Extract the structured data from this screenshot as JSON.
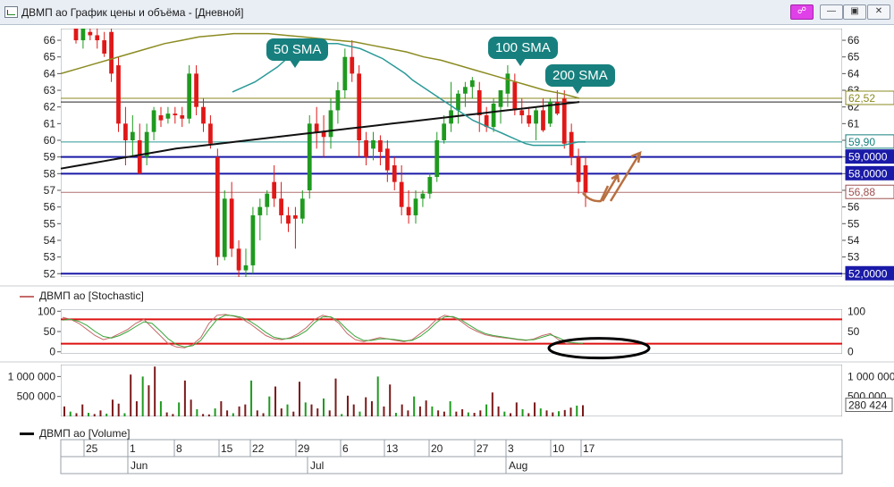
{
  "window": {
    "title": "ДВМП ао График цены и объёма - [Дневной]",
    "buttons": [
      "☍",
      "—",
      "▣",
      "✕"
    ]
  },
  "annotations": {
    "sma50": "50 SMA",
    "sma100": "100 SMA",
    "sma200": "200 SMA"
  },
  "legends": {
    "stochastic": "ДВМП ао [Stochastic]",
    "volume": "ДВМП ао [Volume]"
  },
  "price_tags": {
    "sma200": {
      "label": "62,52",
      "value": 62.52,
      "color": "#8b8b22"
    },
    "sma50": {
      "label": "59,90",
      "value": 59.9,
      "color": "#17807e"
    },
    "level59": {
      "label": "59,0000",
      "value": 59.0,
      "color": "#1a1aa8"
    },
    "level58": {
      "label": "58,0000",
      "value": 58.0,
      "color": "#1a1aa8"
    },
    "last": {
      "label": "56,88",
      "value": 56.88,
      "color": "#a05050"
    },
    "level52": {
      "label": "52,0000",
      "value": 52.0,
      "color": "#1a1aa8"
    },
    "volume_last": {
      "label": "280 424",
      "value": 280424
    }
  },
  "colors": {
    "up": "#1f9a1f",
    "down": "#e01818",
    "sma50": "#2a9a98",
    "sma100": "#111111",
    "sma200": "#8b8b22",
    "level": "#1a1aa8",
    "stoch_band": "#dd1111",
    "draw": "#b87040"
  },
  "chart_data": [
    {
      "type": "candlestick",
      "ylim": [
        51.8,
        66.7
      ],
      "yticks": [
        52,
        53,
        54,
        55,
        56,
        57,
        58,
        59,
        60,
        61,
        62,
        63,
        64,
        65,
        66
      ],
      "x_labels": [
        "25",
        "1",
        "8",
        "15",
        "22",
        "29",
        "6",
        "13",
        "20",
        "27",
        "3",
        "10",
        "17"
      ],
      "month_labels": [
        "Jun",
        "Jul",
        "Aug"
      ],
      "horizontal_lines": [
        62.52,
        62.3,
        59.9,
        59.0,
        58.0,
        56.88,
        52.0
      ],
      "ohlc": [
        [
          67.0,
          67.5,
          65.8,
          66.0
        ],
        [
          66.0,
          67.0,
          65.5,
          66.8
        ],
        [
          66.5,
          67.0,
          66.0,
          66.3
        ],
        [
          66.3,
          67.0,
          65.5,
          66.0
        ],
        [
          66.0,
          66.5,
          65.0,
          65.2
        ],
        [
          66.5,
          66.8,
          63.5,
          64.0
        ],
        [
          64.5,
          65.0,
          60.5,
          61.0
        ],
        [
          61.0,
          62.0,
          58.5,
          60.0
        ],
        [
          60.0,
          61.5,
          59.0,
          60.5
        ],
        [
          60.0,
          61.0,
          58.0,
          58.0
        ],
        [
          59.0,
          61.0,
          58.5,
          60.5
        ],
        [
          60.5,
          62.0,
          60.0,
          61.8
        ],
        [
          61.5,
          62.0,
          60.8,
          61.2
        ],
        [
          61.3,
          62.0,
          61.0,
          61.6
        ],
        [
          61.6,
          62.0,
          61.0,
          61.5
        ],
        [
          61.5,
          62.0,
          60.8,
          61.3
        ],
        [
          61.3,
          64.5,
          61.0,
          64.0
        ],
        [
          64.0,
          64.5,
          61.5,
          62.0
        ],
        [
          62.0,
          62.5,
          60.5,
          61.0
        ],
        [
          61.0,
          61.5,
          59.5,
          59.8
        ],
        [
          59.0,
          59.5,
          52.5,
          53.0
        ],
        [
          53.0,
          57.0,
          52.8,
          56.5
        ],
        [
          56.5,
          57.5,
          53.0,
          53.5
        ],
        [
          53.5,
          54.0,
          51.8,
          52.2
        ],
        [
          52.2,
          53.5,
          51.8,
          52.5
        ],
        [
          52.5,
          56.0,
          52.0,
          55.5
        ],
        [
          55.5,
          56.5,
          54.0,
          56.0
        ],
        [
          56.0,
          57.0,
          55.5,
          56.8
        ],
        [
          57.5,
          58.5,
          56.0,
          56.5
        ],
        [
          56.5,
          57.5,
          55.0,
          55.5
        ],
        [
          55.5,
          56.0,
          54.5,
          55.0
        ],
        [
          55.5,
          56.0,
          53.5,
          55.3
        ],
        [
          55.3,
          57.0,
          55.0,
          56.5
        ],
        [
          57.0,
          61.5,
          56.5,
          61.0
        ],
        [
          61.0,
          62.0,
          59.5,
          60.5
        ],
        [
          60.5,
          61.5,
          59.0,
          60.2
        ],
        [
          60.2,
          62.5,
          59.5,
          61.8
        ],
        [
          61.8,
          63.5,
          61.0,
          63.0
        ],
        [
          63.0,
          65.5,
          62.5,
          65.0
        ],
        [
          65.0,
          66.0,
          63.5,
          64.0
        ],
        [
          64.0,
          64.5,
          59.0,
          60.0
        ],
        [
          60.0,
          60.5,
          58.5,
          59.0
        ],
        [
          59.5,
          60.5,
          58.8,
          60.0
        ],
        [
          60.0,
          60.3,
          58.5,
          59.3
        ],
        [
          59.5,
          60.0,
          57.5,
          58.2
        ],
        [
          58.5,
          59.0,
          57.0,
          57.5
        ],
        [
          57.5,
          58.5,
          55.5,
          56.0
        ],
        [
          56.0,
          57.0,
          55.0,
          55.5
        ],
        [
          55.5,
          57.0,
          55.0,
          56.5
        ],
        [
          56.5,
          57.0,
          56.0,
          56.8
        ],
        [
          56.8,
          58.0,
          56.5,
          57.8
        ],
        [
          57.8,
          60.5,
          57.5,
          60.0
        ],
        [
          60.0,
          61.5,
          59.8,
          61.0
        ],
        [
          61.0,
          63.5,
          60.5,
          61.8
        ],
        [
          61.8,
          63.0,
          61.0,
          62.8
        ],
        [
          62.8,
          63.5,
          62.0,
          63.2
        ],
        [
          63.2,
          63.8,
          62.5,
          63.6
        ],
        [
          63.0,
          63.5,
          60.5,
          61.5
        ],
        [
          61.5,
          62.0,
          60.5,
          60.8
        ],
        [
          60.8,
          62.5,
          60.5,
          62.2
        ],
        [
          62.0,
          63.0,
          61.0,
          63.0
        ],
        [
          62.8,
          64.5,
          62.0,
          64.0
        ],
        [
          63.5,
          64.0,
          61.5,
          61.8
        ],
        [
          61.8,
          62.5,
          61.0,
          61.5
        ],
        [
          61.5,
          62.0,
          60.8,
          61.0
        ],
        [
          61.0,
          62.0,
          60.0,
          61.8
        ],
        [
          61.8,
          62.5,
          60.5,
          60.6
        ],
        [
          61.0,
          62.5,
          60.8,
          62.3
        ],
        [
          62.3,
          63.0,
          61.5,
          61.6
        ],
        [
          62.5,
          63.0,
          59.5,
          59.8
        ],
        [
          60.5,
          61.0,
          58.5,
          59.0
        ],
        [
          59.0,
          59.5,
          56.8,
          57.5
        ],
        [
          58.5,
          59.0,
          56.0,
          56.88
        ]
      ],
      "sma50": [
        62.9,
        63.1,
        63.3,
        63.5,
        63.8,
        64.1,
        64.4,
        64.8,
        65.2,
        65.4,
        65.6,
        65.7,
        65.8,
        65.8,
        65.8,
        65.7,
        65.6,
        65.5,
        65.3,
        65.1,
        64.9,
        64.6,
        64.3,
        64.0,
        63.6,
        63.3,
        63.0,
        62.7,
        62.4,
        62.1,
        61.8,
        61.5,
        61.2,
        61.0,
        60.8,
        60.6,
        60.4,
        60.2,
        60.0,
        59.8,
        59.7,
        59.7,
        59.7,
        59.7,
        59.7,
        59.8,
        59.9,
        59.9
      ],
      "sma100": [
        58.3,
        58.45,
        58.6,
        58.75,
        58.9,
        59.05,
        59.2,
        59.35,
        59.5,
        59.6,
        59.7,
        59.8,
        59.9,
        60.0,
        60.1,
        60.2,
        60.3,
        60.4,
        60.5,
        60.6,
        60.7,
        60.8,
        60.9,
        61.0,
        61.1,
        61.2,
        61.3,
        61.4,
        61.5,
        61.6,
        61.7,
        61.8,
        61.9,
        62.0,
        62.1,
        62.2,
        62.3
      ],
      "sma200": [
        64.0,
        64.3,
        64.6,
        64.9,
        65.2,
        65.5,
        65.8,
        66.0,
        66.2,
        66.3,
        66.4,
        66.4,
        66.4,
        66.3,
        66.2,
        66.1,
        66.0,
        65.9,
        65.7,
        65.5,
        65.3,
        65.0,
        64.8,
        64.5,
        64.2,
        63.9,
        63.6,
        63.3,
        63.0,
        62.8,
        62.52
      ]
    },
    {
      "type": "line",
      "name": "Stochastic",
      "ylim": [
        -5,
        105
      ],
      "yticks": [
        0,
        50,
        100
      ],
      "bands": [
        20,
        80
      ],
      "series": [
        {
          "values": [
            85,
            80,
            70,
            55,
            40,
            30,
            35,
            45,
            55,
            70,
            80,
            60,
            40,
            20,
            12,
            10,
            18,
            35,
            70,
            90,
            92,
            88,
            82,
            70,
            55,
            40,
            32,
            30,
            35,
            45,
            60,
            80,
            90,
            85,
            70,
            45,
            30,
            25,
            30,
            35,
            32,
            28,
            25,
            30,
            45,
            60,
            80,
            90,
            85,
            75,
            60,
            50,
            42,
            38,
            35,
            33,
            30,
            28,
            32,
            40,
            45,
            30,
            20,
            22,
            21
          ]
        },
        {
          "values": [
            78,
            80,
            75,
            65,
            50,
            38,
            34,
            40,
            50,
            62,
            74,
            70,
            52,
            32,
            18,
            12,
            15,
            28,
            55,
            80,
            90,
            89,
            85,
            76,
            63,
            48,
            36,
            32,
            33,
            40,
            52,
            72,
            86,
            86,
            75,
            55,
            38,
            28,
            28,
            32,
            32,
            30,
            27,
            28,
            38,
            53,
            72,
            86,
            87,
            79,
            66,
            54,
            45,
            40,
            37,
            34,
            31,
            29,
            30,
            36,
            42,
            35,
            25,
            22,
            21
          ]
        }
      ]
    },
    {
      "type": "bar",
      "name": "Volume",
      "ylim": [
        0,
        1300000
      ],
      "yticks": [
        500000,
        1000000
      ],
      "ytick_labels": [
        "500 000",
        "1 000 000"
      ],
      "right_labels": [
        "1 000 000",
        "500 000"
      ],
      "values": [
        250000,
        120000,
        80000,
        300000,
        90000,
        60000,
        150000,
        70000,
        420000,
        320000,
        80000,
        1050000,
        380000,
        1000000,
        780000,
        1250000,
        380000,
        100000,
        60000,
        350000,
        900000,
        420000,
        180000,
        60000,
        50000,
        200000,
        380000,
        150000,
        80000,
        250000,
        300000,
        900000,
        150000,
        80000,
        500000,
        750000,
        200000,
        300000,
        120000,
        870000,
        350000,
        300000,
        200000,
        450000,
        150000,
        950000,
        60000,
        520000,
        300000,
        120000,
        480000,
        380000,
        1000000,
        250000,
        800000,
        90000,
        300000,
        150000,
        500000,
        250000,
        400000,
        250000,
        150000,
        120000,
        380000,
        120000,
        180000,
        100000,
        90000,
        150000,
        300000,
        600000,
        250000,
        120000,
        80000,
        350000,
        180000,
        80000,
        350000,
        200000,
        150000,
        100000,
        130000,
        160000,
        220000,
        270000,
        280424
      ]
    }
  ]
}
